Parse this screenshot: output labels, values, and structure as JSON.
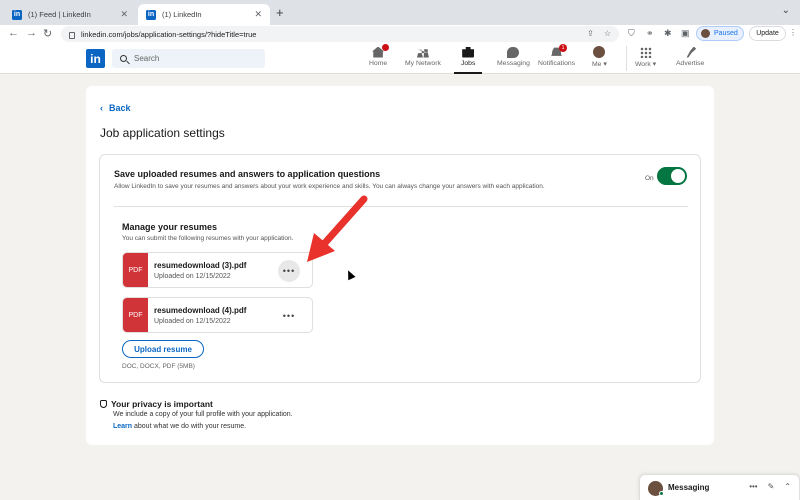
{
  "browser": {
    "tabs": [
      {
        "title": "(1) Feed | LinkedIn",
        "active": false
      },
      {
        "title": "(1) LinkedIn",
        "active": true
      }
    ],
    "url": "linkedin.com/jobs/application-settings/?hideTitle=true",
    "profile_chip": "Paused",
    "update_label": "Update"
  },
  "header": {
    "logo": "in",
    "search_placeholder": "Search",
    "nav": [
      {
        "label": "Home",
        "badge": ""
      },
      {
        "label": "My Network",
        "badge": ""
      },
      {
        "label": "Jobs",
        "badge": ""
      },
      {
        "label": "Messaging",
        "badge": ""
      },
      {
        "label": "Notifications",
        "badge": "1"
      },
      {
        "label": "Me ▾",
        "badge": ""
      },
      {
        "label": "Work ▾",
        "badge": ""
      },
      {
        "label": "Advertise",
        "badge": ""
      }
    ]
  },
  "page": {
    "back_label": "Back",
    "title": "Job application settings",
    "save_section": {
      "title": "Save uploaded resumes and answers to application questions",
      "description": "Allow LinkedIn to save your resumes and answers about your work experience and skills. You can always change your answers with each application.",
      "toggle_label": "On",
      "toggle_on": true
    },
    "resumes": {
      "title": "Manage your resumes",
      "description": "You can submit the following resumes with your application.",
      "items": [
        {
          "badge": "PDF",
          "filename": "resumedownload (3).pdf",
          "uploaded": "Uploaded on 12/15/2022"
        },
        {
          "badge": "PDF",
          "filename": "resumedownload (4).pdf",
          "uploaded": "Uploaded on 12/15/2022"
        }
      ],
      "upload_label": "Upload resume",
      "formats": "DOC, DOCX, PDF (5MB)"
    },
    "privacy": {
      "title": "Your privacy is important",
      "description": "We include a copy of your full profile with your application.",
      "learn_link": "Learn",
      "learn_rest": " about what we do with your resume."
    }
  },
  "messaging": {
    "label": "Messaging"
  },
  "colors": {
    "brand": "#0a66c2",
    "toggle_on": "#057642",
    "pdf_badge": "#d13438",
    "annotation_arrow": "#e8322b"
  }
}
